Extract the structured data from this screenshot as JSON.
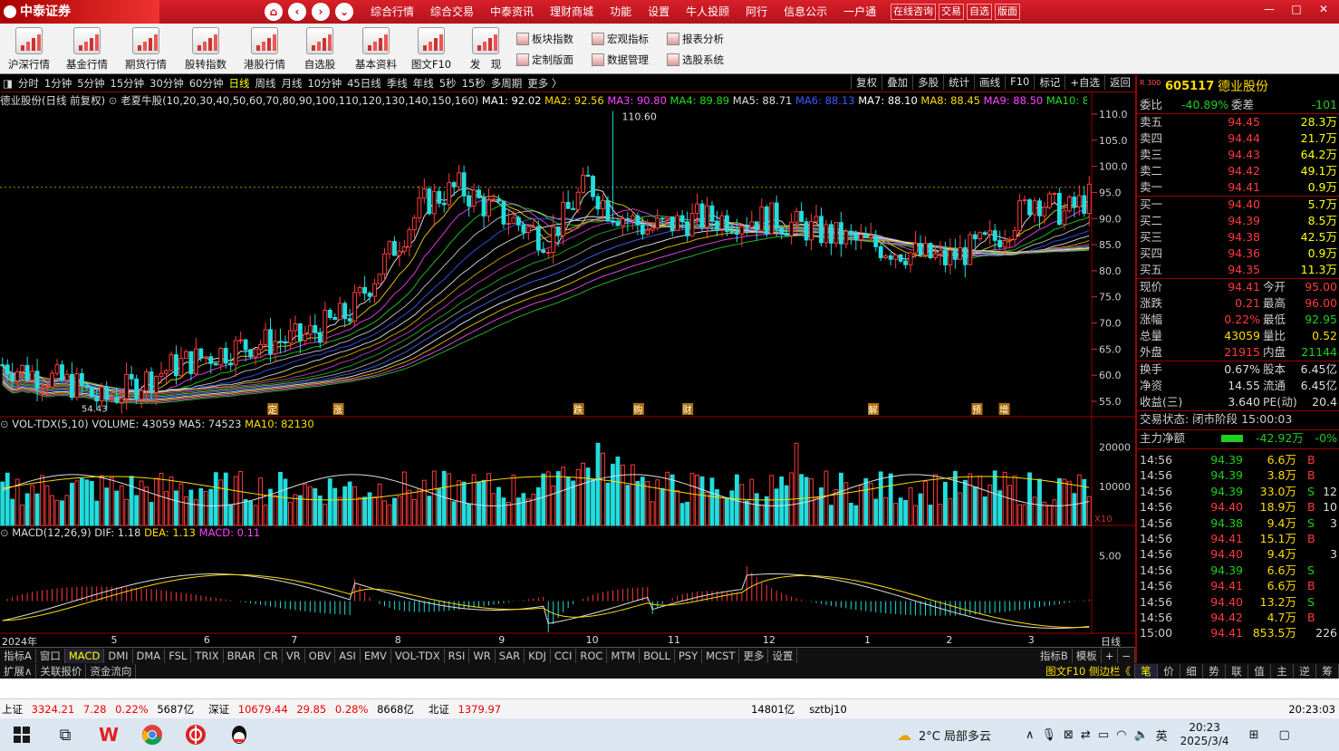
{
  "app": {
    "logo_text": "中泰证券",
    "menus": [
      "综合行情",
      "综合交易",
      "中泰资讯",
      "理财商城",
      "功能",
      "设置",
      "牛人投顾",
      "阿行",
      "信息公示",
      "一户通"
    ],
    "menu_buttons": [
      "在线咨询",
      "交易",
      "自选",
      "版面"
    ],
    "nav_icons": [
      "home-icon",
      "back-icon",
      "forward-icon",
      "dropdown-icon"
    ],
    "window_controls": [
      "—",
      "□",
      "✕"
    ]
  },
  "toolbar": {
    "big": [
      {
        "label": "沪深行情",
        "icon": "chart-icon"
      },
      {
        "label": "基金行情",
        "icon": "chart-icon"
      },
      {
        "label": "期货行情",
        "icon": "chart-icon"
      },
      {
        "label": "股转指数",
        "icon": "chart-icon"
      },
      {
        "label": "港股行情",
        "icon": "chart-icon"
      },
      {
        "label": "自选股",
        "icon": "chart-icon"
      },
      {
        "label": "基本资料",
        "icon": "key-icon"
      },
      {
        "label": "图文F10",
        "icon": "doc-icon"
      },
      {
        "label": "发　现",
        "icon": "chart-icon"
      }
    ],
    "small": [
      "板块指数",
      "宏观指标",
      "报表分析",
      "定制版面",
      "数据管理",
      "选股系统"
    ]
  },
  "periods": [
    "分时",
    "1分钟",
    "5分钟",
    "15分钟",
    "30分钟",
    "60分钟",
    "日线",
    "周线",
    "月线",
    "10分钟",
    "45日线",
    "季线",
    "年线",
    "5秒",
    "15秒",
    "多周期",
    "更多 〉"
  ],
  "selected_period": "日线",
  "right_period_buttons": [
    "复权",
    "叠加",
    "多股",
    "统计",
    "画线",
    "F10",
    "标记",
    "+自选",
    "返回"
  ],
  "info_line": {
    "title": "德业股份(日线 前复权)",
    "indicator": "老夏牛股(10,20,30,40,50,60,70,80,90,100,110,120,130,140,150,160)",
    "ma": [
      {
        "label": "MA1: 92.02",
        "color": "#ffffff"
      },
      {
        "label": "MA2: 92.56",
        "color": "#ffdb00"
      },
      {
        "label": "MA3: 90.80",
        "color": "#ff44ff"
      },
      {
        "label": "MA4: 89.89",
        "color": "#22dd22"
      },
      {
        "label": "MA5: 88.71",
        "color": "#dddddd"
      },
      {
        "label": "MA6: 88.13",
        "color": "#3a5aff"
      },
      {
        "label": "MA7: 88.10",
        "color": "#ffffff"
      },
      {
        "label": "MA8: 88.45",
        "color": "#ffdb00"
      },
      {
        "label": "MA9: 88.50",
        "color": "#ff44ff"
      },
      {
        "label": "MA10: 89.00",
        "color": "#22dd22"
      },
      {
        "label": "MA11: ",
        "color": "#dddddd"
      }
    ]
  },
  "price_axis": [
    "110.0",
    "105.0",
    "100.0",
    "95.0",
    "90.0",
    "85.0",
    "80.0",
    "75.0",
    "70.0",
    "65.0",
    "60.0",
    "55.0"
  ],
  "peak_label": "110.60",
  "low_label": "54.43",
  "event_markers": [
    {
      "t": "定",
      "pos": 0.25
    },
    {
      "t": "涨",
      "pos": 0.31
    },
    {
      "t": "跌",
      "pos": 0.53
    },
    {
      "t": "购",
      "pos": 0.585
    },
    {
      "t": "财",
      "pos": 0.63
    },
    {
      "t": "解",
      "pos": 0.8
    },
    {
      "t": "预",
      "pos": 0.895
    },
    {
      "t": "增",
      "pos": 0.92
    }
  ],
  "volume": {
    "title": "VOL-TDX(5,10)",
    "volume": "VOLUME: 43059",
    "ma5": "MA5: 74523",
    "ma10": "MA10: 82130",
    "axis": [
      "20000",
      "10000"
    ],
    "unit": "X10"
  },
  "macd": {
    "title": "MACD(12,26,9)",
    "dif": "DIF: 1.18",
    "dea": "DEA: 1.13",
    "macd": "MACD: 0.11",
    "axis": [
      "5.00"
    ]
  },
  "time_axis": [
    {
      "t": "2024年",
      "pos": 0.0
    },
    {
      "t": "5",
      "pos": 0.1
    },
    {
      "t": "6",
      "pos": 0.185
    },
    {
      "t": "7",
      "pos": 0.265
    },
    {
      "t": "8",
      "pos": 0.36
    },
    {
      "t": "9",
      "pos": 0.455
    },
    {
      "t": "10",
      "pos": 0.535
    },
    {
      "t": "11",
      "pos": 0.61
    },
    {
      "t": "12",
      "pos": 0.697
    },
    {
      "t": "1",
      "pos": 0.79
    },
    {
      "t": "2",
      "pos": 0.865
    },
    {
      "t": "3",
      "pos": 0.94
    }
  ],
  "time_axis_right": "日线",
  "indicator_tabs": [
    "指标A",
    "窗口",
    "MACD",
    "DMI",
    "DMA",
    "FSL",
    "TRIX",
    "BRAR",
    "CR",
    "VR",
    "OBV",
    "ASI",
    "EMV",
    "VOL-TDX",
    "RSI",
    "WR",
    "SAR",
    "KDJ",
    "CCI",
    "ROC",
    "MTM",
    "BOLL",
    "PSY",
    "MCST",
    "更多",
    "设置"
  ],
  "indicator_selected": "MACD",
  "indicator_right": [
    "指标B",
    "模板",
    "+",
    "−"
  ],
  "bottom_tabs": [
    "扩展∧",
    "关联报价",
    "资金流向"
  ],
  "bottom_right": "图文F10 侧边栏《",
  "quote": {
    "code": "605117",
    "name": "德业股份",
    "market_tag": "R 300",
    "weibi_label": "委比",
    "weibi": "-40.89%",
    "weicha_label": "委差",
    "weicha": "-101",
    "asks": [
      {
        "l": "卖五",
        "p": "94.45",
        "v": "28.3万"
      },
      {
        "l": "卖四",
        "p": "94.44",
        "v": "21.7万"
      },
      {
        "l": "卖三",
        "p": "94.43",
        "v": "64.2万"
      },
      {
        "l": "卖二",
        "p": "94.42",
        "v": "49.1万"
      },
      {
        "l": "卖一",
        "p": "94.41",
        "v": "0.9万"
      }
    ],
    "bids": [
      {
        "l": "买一",
        "p": "94.40",
        "v": "5.7万"
      },
      {
        "l": "买二",
        "p": "94.39",
        "v": "8.5万"
      },
      {
        "l": "买三",
        "p": "94.38",
        "v": "42.5万"
      },
      {
        "l": "买四",
        "p": "94.36",
        "v": "0.9万"
      },
      {
        "l": "买五",
        "p": "94.35",
        "v": "11.3万"
      }
    ],
    "stats": [
      {
        "l1": "现价",
        "v1": "94.41",
        "c1": "red",
        "l2": "今开",
        "v2": "95.00",
        "c2": "red"
      },
      {
        "l1": "涨跌",
        "v1": "0.21",
        "c1": "red",
        "l2": "最高",
        "v2": "96.00",
        "c2": "red"
      },
      {
        "l1": "涨幅",
        "v1": "0.22%",
        "c1": "red",
        "l2": "最低",
        "v2": "92.95",
        "c2": "grn"
      },
      {
        "l1": "总量",
        "v1": "43059",
        "c1": "yel",
        "l2": "量比",
        "v2": "0.52",
        "c2": "yel"
      },
      {
        "l1": "外盘",
        "v1": "21915",
        "c1": "red",
        "l2": "内盘",
        "v2": "21144",
        "c2": "grn"
      }
    ],
    "stats2": [
      {
        "l1": "换手",
        "v1": "0.67%",
        "l2": "股本",
        "v2": "6.45亿"
      },
      {
        "l1": "净资",
        "v1": "14.55",
        "l2": "流通",
        "v2": "6.45亿"
      },
      {
        "l1": "收益(三)",
        "v1": "3.640",
        "l2": "PE(动)",
        "v2": "20.4"
      }
    ],
    "trade_status": "交易状态: 闭市阶段 15:00:03",
    "main_flow_label": "主力净额",
    "main_flow": "-42.92万",
    "main_flow_pct": "-0%",
    "ticks": [
      {
        "t": "14:56",
        "p": "94.39",
        "v": "6.6万",
        "s": "B",
        "n": ""
      },
      {
        "t": "14:56",
        "p": "94.39",
        "v": "3.8万",
        "s": "B",
        "n": ""
      },
      {
        "t": "14:56",
        "p": "94.39",
        "v": "33.0万",
        "s": "S",
        "n": "12"
      },
      {
        "t": "14:56",
        "p": "94.40",
        "v": "18.9万",
        "s": "B",
        "n": "10"
      },
      {
        "t": "14:56",
        "p": "94.38",
        "v": "9.4万",
        "s": "S",
        "n": "3"
      },
      {
        "t": "14:56",
        "p": "94.41",
        "v": "15.1万",
        "s": "B",
        "n": ""
      },
      {
        "t": "14:56",
        "p": "94.40",
        "v": "9.4万",
        "s": "",
        "n": "3"
      },
      {
        "t": "14:56",
        "p": "94.39",
        "v": "6.6万",
        "s": "S",
        "n": ""
      },
      {
        "t": "14:56",
        "p": "94.41",
        "v": "6.6万",
        "s": "B",
        "n": ""
      },
      {
        "t": "14:56",
        "p": "94.40",
        "v": "13.2万",
        "s": "S",
        "n": ""
      },
      {
        "t": "14:56",
        "p": "94.42",
        "v": "4.7万",
        "s": "B",
        "n": ""
      },
      {
        "t": "15:00",
        "p": "94.41",
        "v": "853.5万",
        "s": "",
        "n": "226"
      }
    ],
    "bottom_tabs": [
      "笔",
      "价",
      "细",
      "势",
      "联",
      "值",
      "主",
      "逆",
      "筹"
    ]
  },
  "statusbar": {
    "items": [
      {
        "name": "上证",
        "val": "3324.21",
        "chg": "7.28",
        "pct": "0.22%",
        "amt": "5687亿"
      },
      {
        "name": "深证",
        "val": "10679.44",
        "chg": "29.85",
        "pct": "0.28%",
        "amt": "8668亿"
      },
      {
        "name": "北证",
        "val": "1379.97",
        "chg": "",
        "pct": "",
        "amt": ""
      }
    ],
    "extra": "14801亿",
    "user": "sztbj10",
    "time": "20:23:03"
  },
  "taskbar": {
    "weather": "2°C 局部多云",
    "ime": "英",
    "time": "20:23",
    "date": "2025/3/4"
  },
  "colors": {
    "up": "#ff3a3a",
    "down": "#22dddd",
    "accent": "#d8202a"
  }
}
